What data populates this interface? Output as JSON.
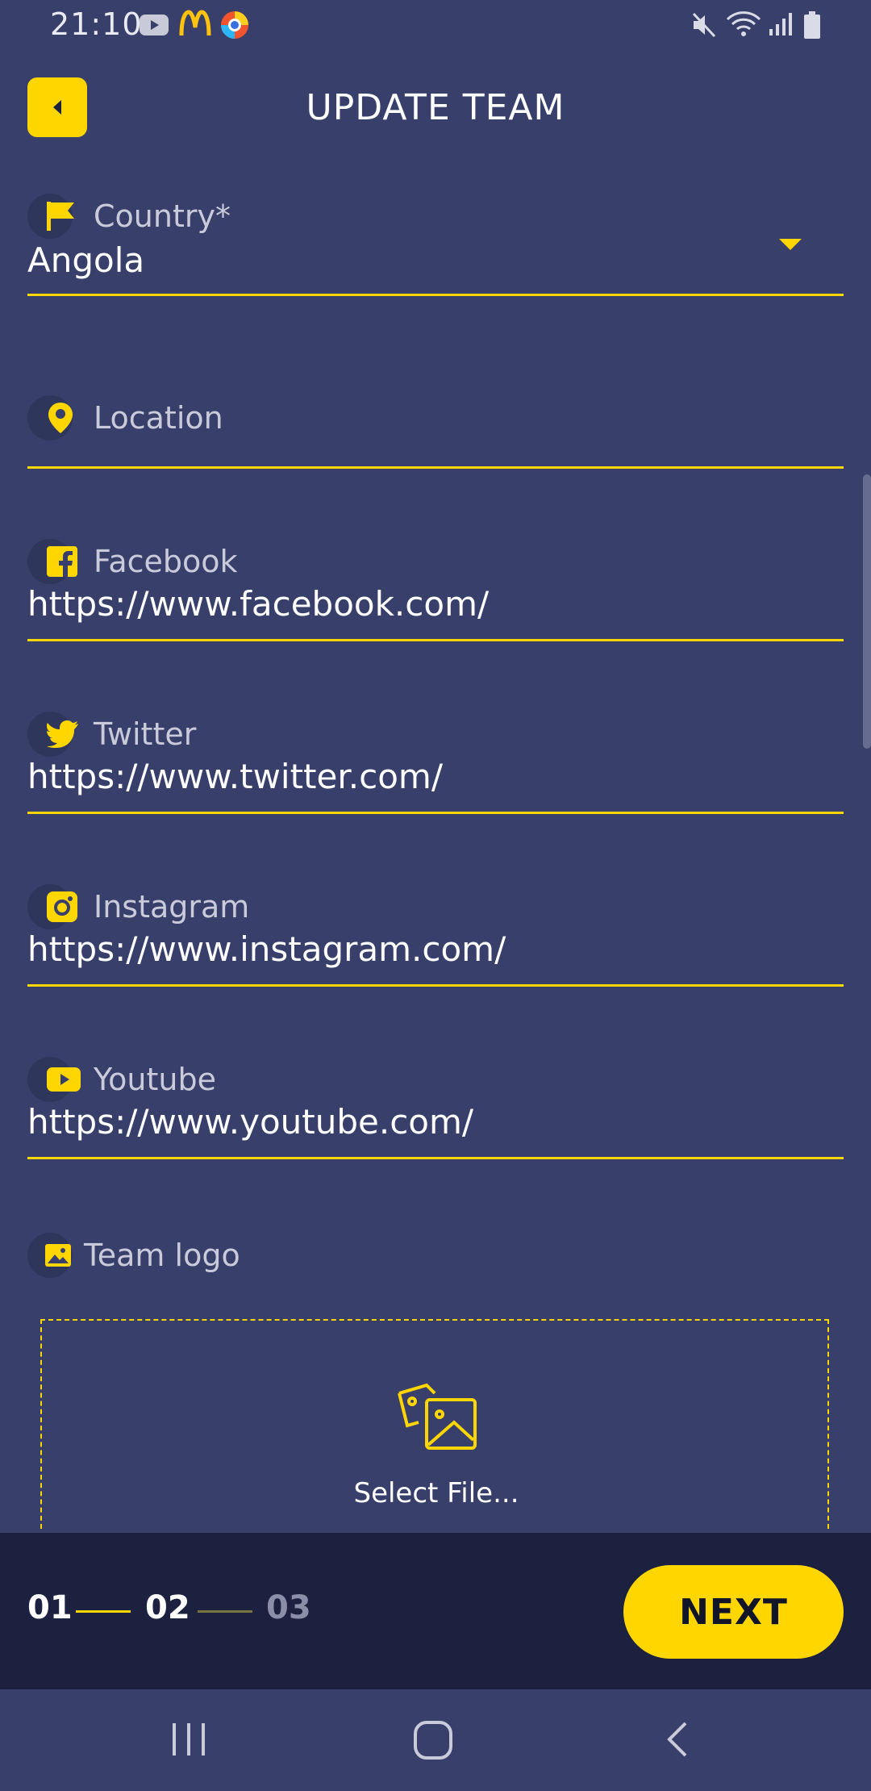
{
  "status_bar": {
    "time": "21:10"
  },
  "app_bar": {
    "title": "UPDATE TEAM"
  },
  "form": {
    "country": {
      "label": "Country*",
      "value": "Angola"
    },
    "location": {
      "label": "Location",
      "value": ""
    },
    "facebook": {
      "label": "Facebook",
      "value": "https://www.facebook.com/"
    },
    "twitter": {
      "label": "Twitter",
      "value": "https://www.twitter.com/"
    },
    "instagram": {
      "label": "Instagram",
      "value": "https://www.instagram.com/"
    },
    "youtube": {
      "label": "Youtube",
      "value": "https://www.youtube.com/"
    },
    "team_logo": {
      "label": "Team logo",
      "select_label": "Select File..."
    }
  },
  "stepper": {
    "steps": [
      "01",
      "02",
      "03"
    ],
    "next_label": "NEXT"
  },
  "colors": {
    "accent": "#ffd600",
    "background": "#373f6a",
    "bottom_bar": "#1c2140"
  }
}
